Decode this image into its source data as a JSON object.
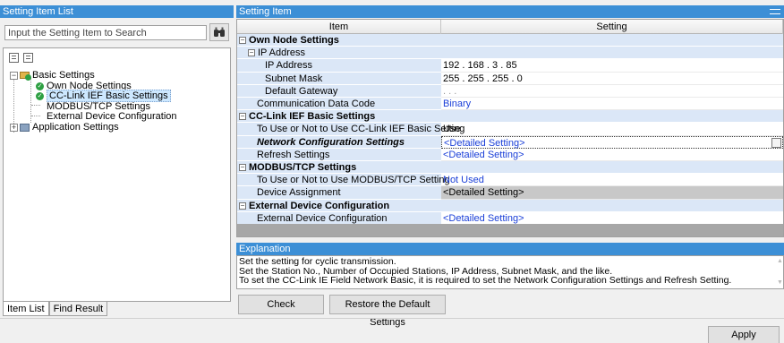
{
  "left_panel": {
    "title": "Setting Item List",
    "search": {
      "placeholder": "Input the Setting Item to Search"
    },
    "tree": {
      "basic_settings": "Basic Settings",
      "own_node_settings": "Own Node Settings",
      "cc_link_ief_basic_settings": "CC-Link IEF Basic Settings",
      "modbus_tcp_settings": "MODBUS/TCP Settings",
      "external_device_configuration": "External Device Configuration",
      "application_settings": "Application Settings",
      "selected": "CC-Link IEF Basic Settings"
    },
    "tabs": [
      "Item List",
      "Find Result"
    ]
  },
  "right_panel": {
    "title": "Setting Item",
    "columns": {
      "item": "Item",
      "setting": "Setting"
    },
    "rows": [
      {
        "item": "Own Node Settings",
        "setting": ""
      },
      {
        "item": "IP Address",
        "setting": ""
      },
      {
        "item": "IP Address",
        "setting": "192 . 168 .  3 . 85"
      },
      {
        "item": "Subnet Mask",
        "setting": "255 . 255 . 255 .  0"
      },
      {
        "item": "Default Gateway",
        "setting": " .  .  ."
      },
      {
        "item": "Communication Data Code",
        "setting": "Binary"
      },
      {
        "item": "CC-Link IEF Basic Settings",
        "setting": ""
      },
      {
        "item": "To Use or Not to Use CC-Link IEF Basic Setting",
        "setting": "Use"
      },
      {
        "item": "Network Configuration Settings",
        "setting": "<Detailed Setting>"
      },
      {
        "item": "Refresh Settings",
        "setting": "<Detailed Setting>"
      },
      {
        "item": "MODBUS/TCP Settings",
        "setting": ""
      },
      {
        "item": "To Use or Not to Use MODBUS/TCP Setting",
        "setting": "Not Used"
      },
      {
        "item": "Device Assignment",
        "setting": "<Detailed Setting>"
      },
      {
        "item": "External Device Configuration",
        "setting": ""
      },
      {
        "item": "External Device Configuration",
        "setting": "<Detailed Setting>"
      }
    ]
  },
  "explanation": {
    "title": "Explanation",
    "lines": [
      "Set the setting for cyclic transmission.",
      "Set the Station No., Number of Occupied Stations, IP Address, Subnet Mask, and the like.",
      "To set the CC-Link IE Field Network Basic, it is required to set the Network Configuration Settings and Refresh Setting."
    ]
  },
  "buttons": {
    "check": "Check",
    "restore": "Restore the Default Settings",
    "apply": "Apply"
  },
  "colors": {
    "title_bar": "#3c8fd6",
    "item_column_bg": "#dbe7f7",
    "link_text": "#1a3fd8",
    "disabled_cell": "#c8c8c8"
  },
  "icons": {
    "search": "binoculars-icon",
    "expand": "expand-icon",
    "collapse": "collapse-icon",
    "ok": "checkmark-icon",
    "folder": "folder-icon"
  }
}
